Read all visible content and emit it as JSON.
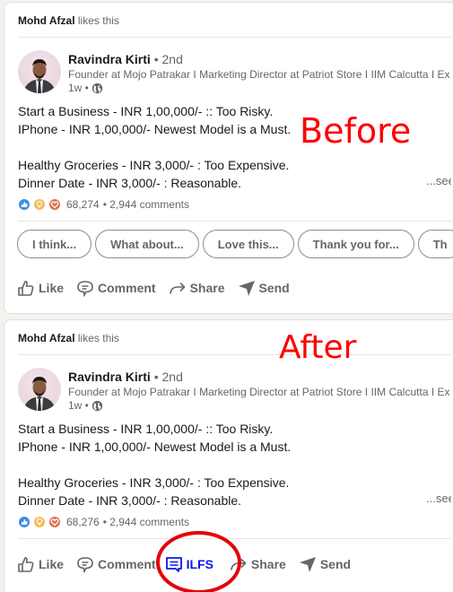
{
  "posts": [
    {
      "liker": {
        "name": "Mohd Afzal",
        "action": "likes this"
      },
      "author": {
        "name": "Ravindra Kirti",
        "degree": "• 2nd",
        "headline": "Founder at Mojo Patrakar I Marketing Director at Patriot Store I IIM Calcutta I Ex",
        "time": "1w •",
        "visibility_icon": "globe-icon"
      },
      "body": "Start a Business - INR 1,00,000/- :: Too Risky.\nIPhone - INR 1,00,000/- Newest Model is a Must.\n\nHealthy Groceries - INR 3,000/- : Too Expensive.\nDinner Date - INR 3,000/- : Reasonable.",
      "see_more": "...see more",
      "reactions": {
        "icons": [
          "like",
          "insightful",
          "love"
        ],
        "count": "68,274",
        "comments": "• 2,944 comments"
      },
      "suggestions": [
        "I think...",
        "What about...",
        "Love this...",
        "Thank you for...",
        "Th"
      ],
      "actions": [
        {
          "label": "Like",
          "icon": "thumbs-up-icon"
        },
        {
          "label": "Comment",
          "icon": "comment-icon"
        },
        {
          "label": "Share",
          "icon": "share-icon"
        },
        {
          "label": "Send",
          "icon": "send-icon"
        }
      ],
      "annotation": "Before"
    },
    {
      "liker": {
        "name": "Mohd Afzal",
        "action": "likes this"
      },
      "author": {
        "name": "Ravindra Kirti",
        "degree": "• 2nd",
        "headline": "Founder at Mojo Patrakar I Marketing Director at Patriot Store I IIM Calcutta I Ex",
        "time": "1w •",
        "visibility_icon": "globe-icon"
      },
      "body": "Start a Business - INR 1,00,000/- :: Too Risky.\nIPhone - INR 1,00,000/- Newest Model is a Must.\n\nHealthy Groceries - INR 3,000/- : Too Expensive.\nDinner Date - INR 3,000/- : Reasonable.",
      "see_more": "...see",
      "reactions": {
        "icons": [
          "like",
          "insightful",
          "love"
        ],
        "count": "68,276",
        "comments": "• 2,944 comments"
      },
      "actions": [
        {
          "label": "Like",
          "icon": "thumbs-up-icon"
        },
        {
          "label": "Comment",
          "icon": "comment-icon"
        },
        {
          "label": "ILFS",
          "icon": "message-icon"
        },
        {
          "label": "Share",
          "icon": "share-icon"
        },
        {
          "label": "Send",
          "icon": "send-icon"
        }
      ],
      "annotation": "After"
    }
  ],
  "colors": {
    "annotation": "#ff0000",
    "highlight": "#0a17e6",
    "muted": "#666666"
  }
}
